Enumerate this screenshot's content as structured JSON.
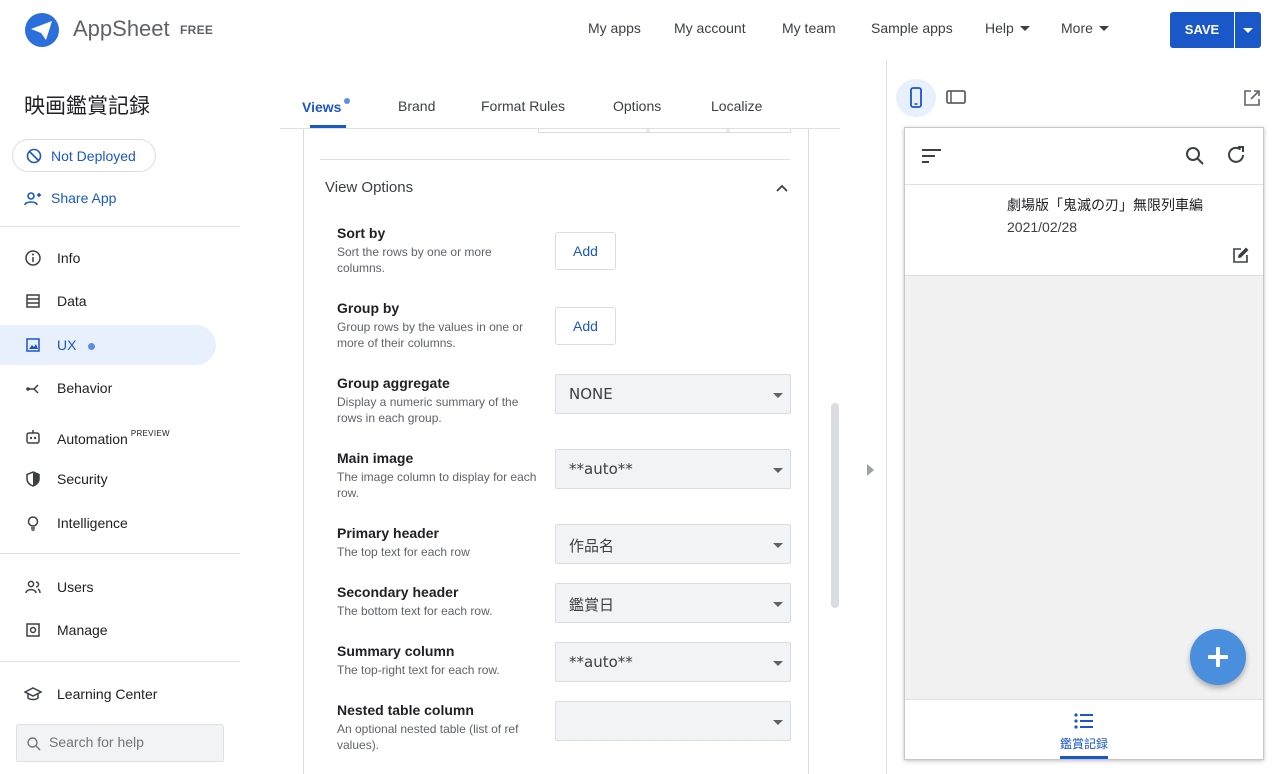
{
  "header": {
    "brand": "AppSheet",
    "plan": "FREE",
    "nav": [
      "My apps",
      "My account",
      "My team",
      "Sample apps",
      "Help",
      "More"
    ],
    "save_label": "SAVE"
  },
  "sidebar": {
    "app_name": "映画鑑賞記録",
    "deploy_status": "Not Deployed",
    "share_label": "Share App",
    "items": [
      "Info",
      "Data",
      "UX",
      "Behavior",
      "Automation",
      "Security",
      "Intelligence"
    ],
    "automation_badge": "PREVIEW",
    "items2": [
      "Users",
      "Manage"
    ],
    "learning": "Learning Center",
    "search_placeholder": "Search for help"
  },
  "tabs": [
    "Views",
    "Brand",
    "Format Rules",
    "Options",
    "Localize"
  ],
  "view_options": {
    "title": "View Options",
    "sort_by": {
      "label": "Sort by",
      "desc": "Sort the rows by one or more columns.",
      "button": "Add"
    },
    "group_by": {
      "label": "Group by",
      "desc": "Group rows by the values in one or more of their columns.",
      "button": "Add"
    },
    "group_aggregate": {
      "label": "Group aggregate",
      "desc": "Display a numeric summary of the rows in each group.",
      "value": "NONE"
    },
    "main_image": {
      "label": "Main image",
      "desc": "The image column to display for each row.",
      "value": "**auto**"
    },
    "primary_header": {
      "label": "Primary header",
      "desc": "The top text for each row",
      "value": "作品名"
    },
    "secondary_header": {
      "label": "Secondary header",
      "desc": "The bottom text for each row.",
      "value": "鑑賞日"
    },
    "summary_column": {
      "label": "Summary column",
      "desc": "The top-right text for each row.",
      "value": "**auto**"
    },
    "nested_table": {
      "label": "Nested table column",
      "desc": "An optional nested table (list of ref values).",
      "value": ""
    }
  },
  "preview": {
    "row_title": "劇場版「鬼滅の刃」無限列車編",
    "row_date": "2021/02/28",
    "bottom_tab": "鑑賞記録"
  },
  "colors": {
    "accent": "#1a57c9",
    "fab": "#4a8fde",
    "active_nav_bg": "#e8f0fe"
  }
}
